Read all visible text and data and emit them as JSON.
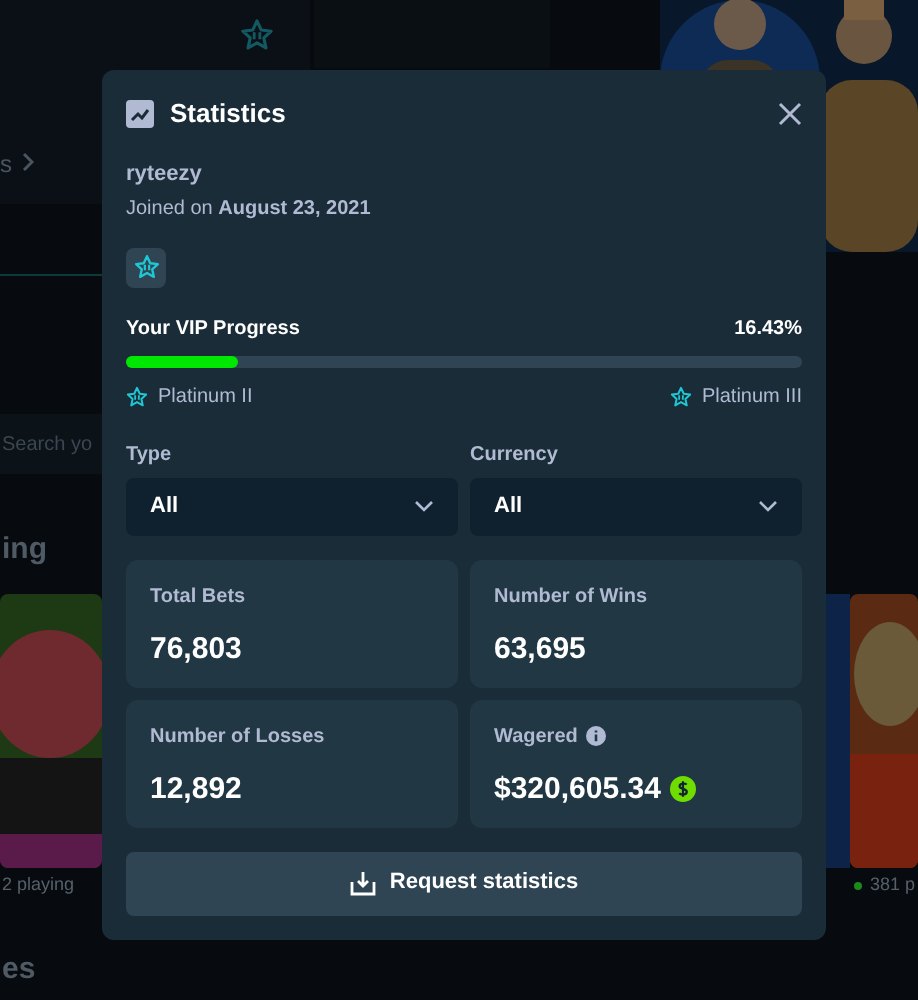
{
  "background": {
    "nav_label": "s",
    "search_placeholder": "Search yo",
    "section_titles": [
      "ing",
      "es"
    ],
    "tiles": [
      {
        "kind": "picture",
        "players": "2 playing"
      },
      {
        "kind": "picture",
        "players": "381 p"
      }
    ]
  },
  "modal": {
    "title": "Statistics",
    "username": "ryteezy",
    "joined": "Joined on **August 23, 2021**",
    "vip": {
      "label": "Your VIP Progress",
      "percent": "16.43%",
      "level": 0.1643,
      "current_tier": "Platinum II",
      "next_tier": "Platinum III"
    },
    "filters": [
      {
        "label": "Type",
        "value": "All"
      },
      {
        "label": "Currency",
        "value": "All"
      }
    ],
    "stats": [
      {
        "label": "Total Bets",
        "value": "76,803",
        "info": false,
        "currency": false
      },
      {
        "label": "Number of Wins",
        "value": "63,695",
        "info": false,
        "currency": false
      },
      {
        "label": "Number of Losses",
        "value": "12,892",
        "info": false,
        "currency": false
      },
      {
        "label": "Wagered",
        "value": "$320,605.34",
        "info": true,
        "currency": true
      }
    ],
    "button": "Request statistics"
  }
}
